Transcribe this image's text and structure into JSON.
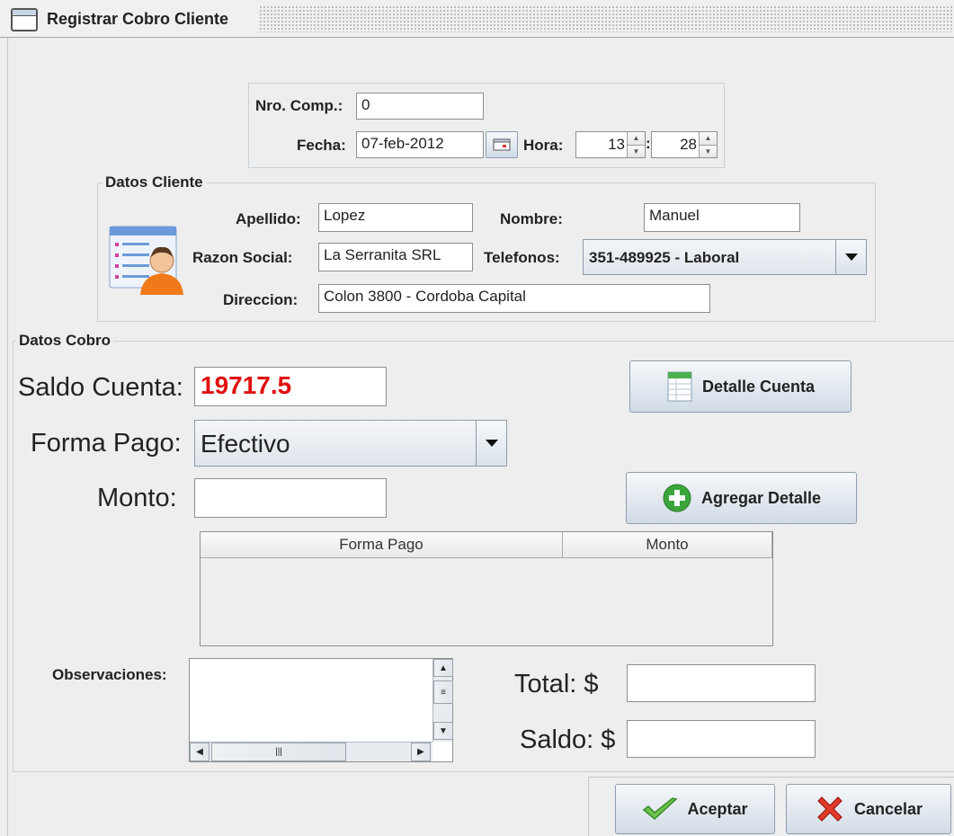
{
  "window": {
    "title": "Registrar Cobro Cliente"
  },
  "comprobante": {
    "nro_label": "Nro. Comp.:",
    "nro_value": "0",
    "fecha_label": "Fecha:",
    "fecha_value": "07-feb-2012",
    "hora_label": "Hora:",
    "hora_value": "13",
    "minuto_value": "28",
    "separator": ":"
  },
  "cliente": {
    "group_title": "Datos Cliente",
    "apellido_label": "Apellido:",
    "apellido_value": "Lopez",
    "nombre_label": "Nombre:",
    "nombre_value": "Manuel",
    "razon_label": "Razon Social:",
    "razon_value": "La Serranita SRL",
    "telefonos_label": "Telefonos:",
    "telefonos_value": "351-489925 - Laboral",
    "direccion_label": "Direccion:",
    "direccion_value": "Colon 3800 - Cordoba Capital"
  },
  "cobro": {
    "group_title": "Datos Cobro",
    "saldo_label": "Saldo Cuenta:",
    "saldo_value": "19717.5",
    "saldo_color": "#e01010",
    "detalle_cuenta_label": "Detalle Cuenta",
    "forma_pago_label": "Forma Pago:",
    "forma_pago_value": "Efectivo",
    "monto_label": "Monto:",
    "monto_value": "",
    "agregar_detalle_label": "Agregar Detalle",
    "table": {
      "columns": [
        "Forma Pago",
        "Monto"
      ],
      "rows": []
    },
    "observaciones_label": "Observaciones:",
    "observaciones_value": "",
    "total_label": "Total: $",
    "total_value": "",
    "saldo2_label": "Saldo: $",
    "saldo2_value": ""
  },
  "actions": {
    "aceptar_label": "Aceptar",
    "cancelar_label": "Cancelar"
  },
  "icons": [
    "window-icon",
    "calendar-icon",
    "client-card-icon",
    "spreadsheet-icon",
    "plus-icon",
    "check-icon",
    "x-icon",
    "chevron-down-icon"
  ]
}
